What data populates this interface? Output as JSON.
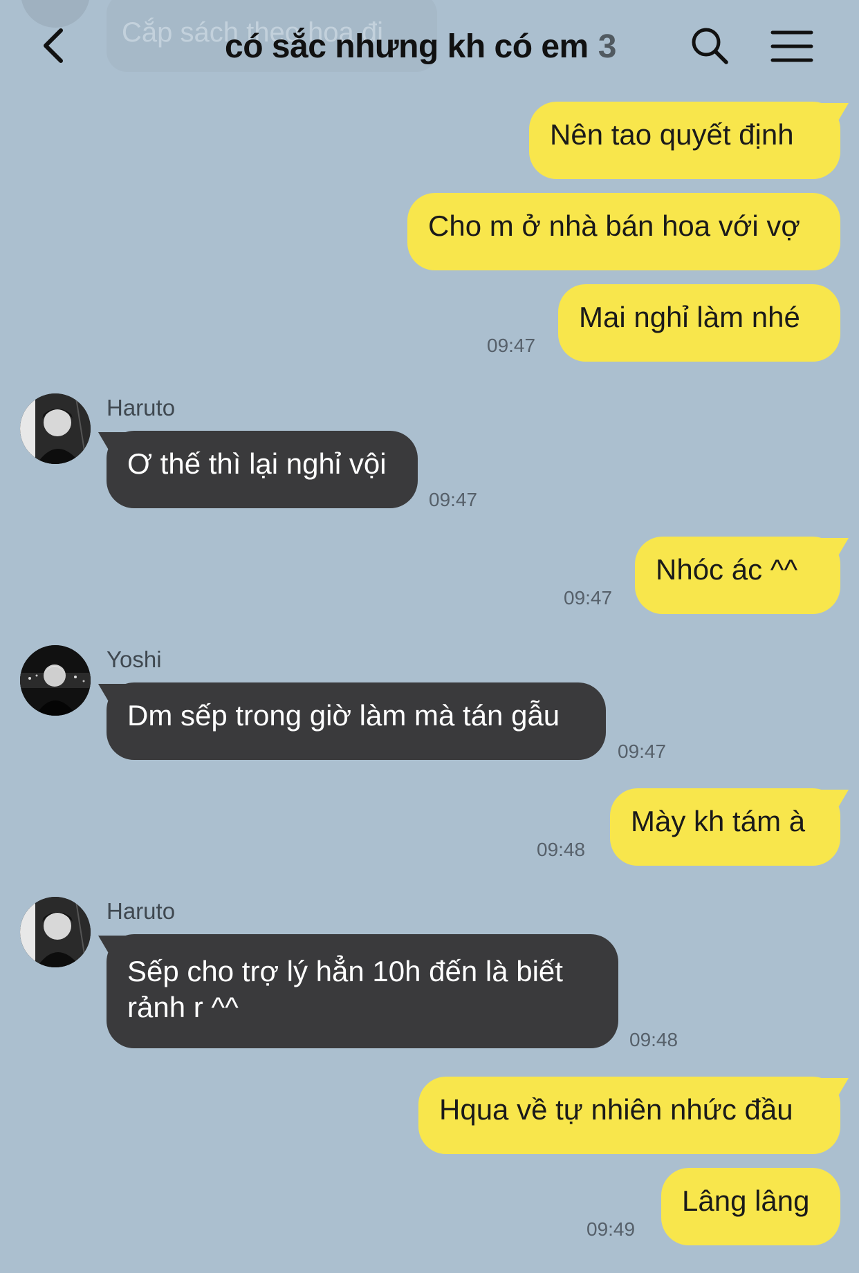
{
  "header": {
    "title": "có sắc nhưng kh có em",
    "member_count": "3",
    "icons": [
      "back-icon",
      "search-icon",
      "menu-icon"
    ]
  },
  "background_message": {
    "text": "Cắp sách theo hoa đi"
  },
  "colors": {
    "background": "#abbfcf",
    "my_bubble": "#f8e64c",
    "other_bubble": "#3a3a3c",
    "timestamp": "#56606a"
  },
  "messages": [
    {
      "from": "me",
      "text": "Nên tao quyết định"
    },
    {
      "from": "me",
      "text": "Cho m ở nhà bán hoa với vợ"
    },
    {
      "from": "me",
      "text": "Mai nghỉ làm nhé",
      "time": "09:47"
    },
    {
      "from": "Haruto",
      "sender_label": "Haruto",
      "text": "Ơ thế thì lại nghỉ vội",
      "time": "09:47"
    },
    {
      "from": "me",
      "text": "Nhóc ác ^^",
      "time": "09:47"
    },
    {
      "from": "Yoshi",
      "sender_label": "Yoshi",
      "text": "Dm sếp trong giờ làm mà tán gẫu",
      "time": "09:47"
    },
    {
      "from": "me",
      "text": "Mày kh tám à",
      "time": "09:48"
    },
    {
      "from": "Haruto",
      "sender_label": "Haruto",
      "text": "Sếp cho trợ lý hẳn 10h đến là biết rảnh r ^^",
      "time": "09:48"
    },
    {
      "from": "me",
      "text": "Hqua về tự nhiên nhức đầu"
    },
    {
      "from": "me",
      "text": "Lâng lâng",
      "time": "09:49"
    }
  ]
}
